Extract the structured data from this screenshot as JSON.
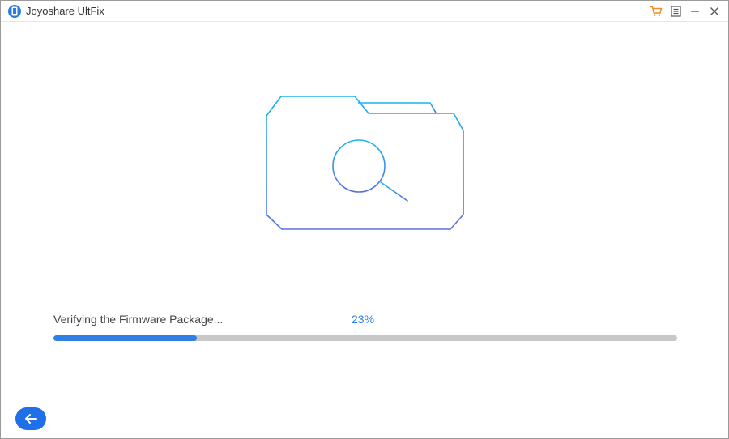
{
  "window": {
    "title": "Joyoshare UltFix"
  },
  "icons": {
    "app": "app-logo-icon",
    "cart": "cart-icon",
    "menu": "menu-icon",
    "minimize": "minimize-icon",
    "close": "close-icon",
    "illustration": "folder-search-icon",
    "back": "arrow-left-icon"
  },
  "progress": {
    "label": "Verifying the Firmware Package...",
    "percent_text": "23%",
    "fraction": 0.23
  },
  "colors": {
    "accent": "#2f7fe6",
    "cart": "#f08c2a",
    "illustration_top": "#17b4f0",
    "illustration_bottom": "#5a6fe0"
  }
}
